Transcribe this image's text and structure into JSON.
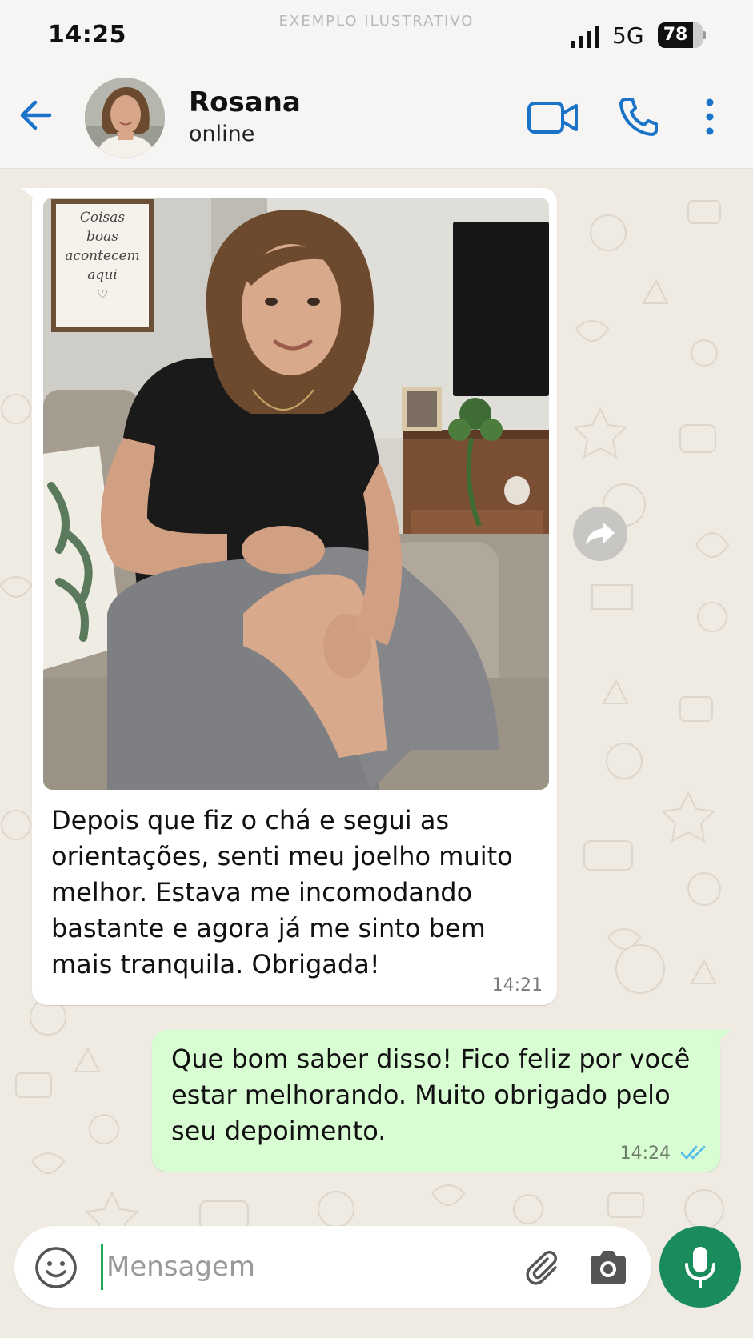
{
  "status_bar": {
    "time": "14:25",
    "watermark": "EXEMPLO ILUSTRATIVO",
    "network": "5G",
    "battery_level": "78",
    "icons": [
      "signal-icon",
      "battery-icon"
    ]
  },
  "header": {
    "contact_name": "Rosana",
    "contact_status": "online",
    "icons": [
      "back-arrow-icon",
      "video-camera-icon",
      "phone-icon",
      "more-vertical-icon"
    ]
  },
  "messages": [
    {
      "direction": "incoming",
      "has_photo": true,
      "photo_sign_text": "Coisas boas acontecem aqui ♡",
      "text": "Depois que fiz o chá e segui as orientações, senti meu joelho muito melhor. Estava me incomodando bastante e agora já me sinto bem mais tranquila. Obrigada!",
      "time": "14:21"
    },
    {
      "direction": "outgoing",
      "text": "Que bom saber disso! Fico feliz por você estar melhorando. Muito obrigado pelo seu depoimento.",
      "time": "14:24",
      "status": "read"
    }
  ],
  "composer": {
    "placeholder": "Mensagem",
    "value": "",
    "icons": [
      "emoji-icon",
      "paperclip-icon",
      "camera-icon",
      "microphone-icon",
      "forward-icon"
    ]
  },
  "colors": {
    "accent_blue": "#1a73c9",
    "chat_background": "#efeae2",
    "outgoing_bubble": "#d9fdd3",
    "incoming_bubble": "#ffffff",
    "mic_green": "#1a8c5b",
    "read_tick_blue": "#53bdeb"
  }
}
